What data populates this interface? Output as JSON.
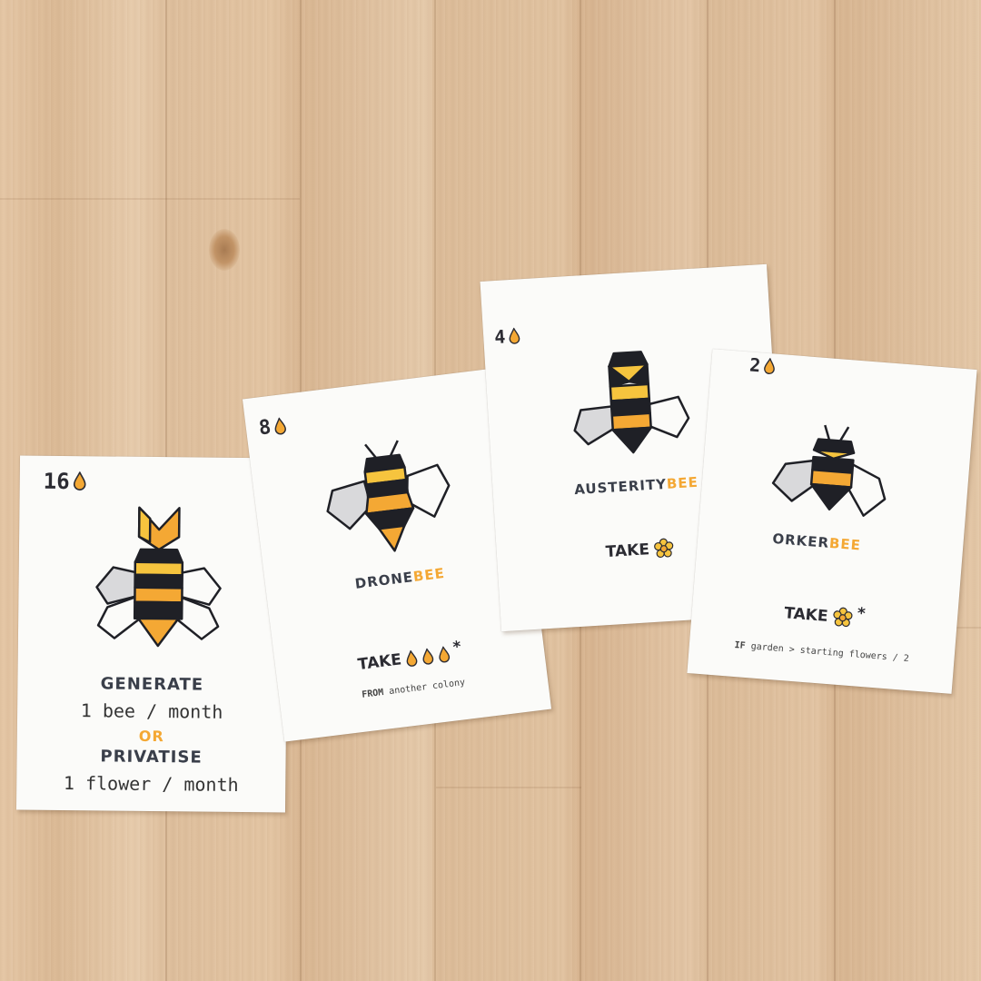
{
  "colors": {
    "honey": "#f4a834",
    "dark": "#2c2c33",
    "wing": "#d9d9db",
    "card": "#fbfbf9"
  },
  "cards": [
    {
      "cost": "16",
      "lines": {
        "generate": "GENERATE",
        "generate_detail": "1 bee / month",
        "or": "OR",
        "privatise": "PRIVATISE",
        "privatise_detail": "1 flower / month"
      }
    },
    {
      "cost": "8",
      "name_main": "DRONE",
      "name_hl": "BEE",
      "action": "TAKE",
      "action_suffix": "*",
      "note_bold": "FROM",
      "note_rest": "another colony"
    },
    {
      "cost": "4",
      "name_main": "AUSTERITY",
      "name_hl": "BEE",
      "action": "TAKE"
    },
    {
      "cost": "2",
      "name_main": "ORKER",
      "name_hl": "BEE",
      "action": "TAKE",
      "action_suffix": "*",
      "note_bold": "IF",
      "note_rest": "garden > starting flowers / 2"
    }
  ]
}
